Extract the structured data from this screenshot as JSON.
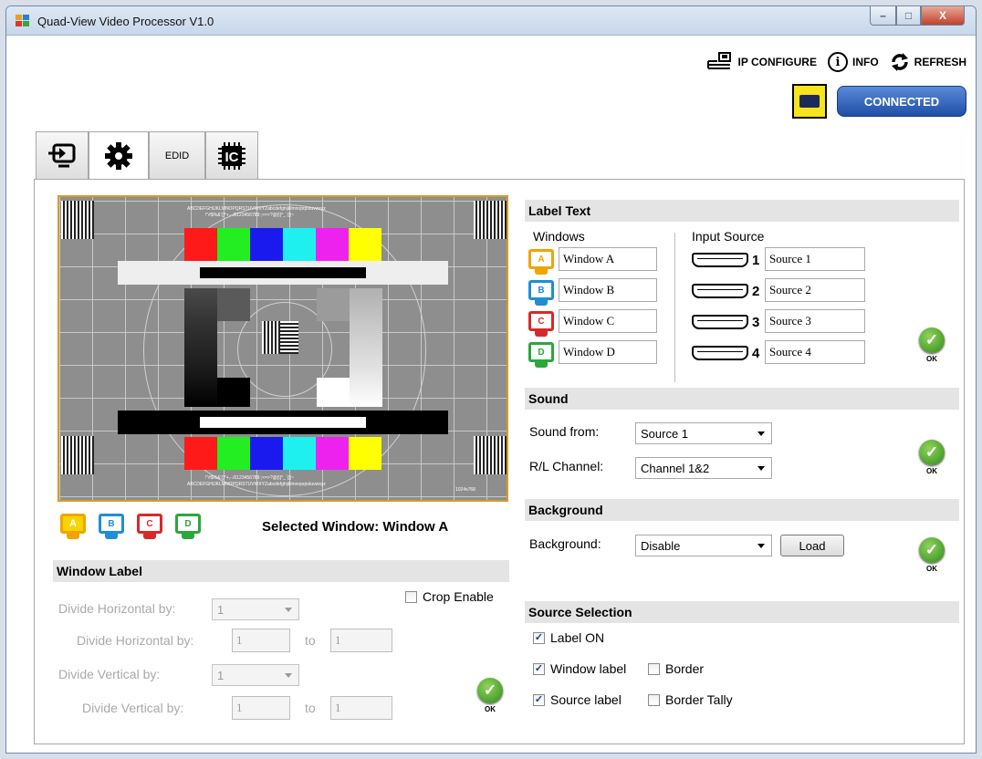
{
  "window": {
    "title": "Quad-View Video Processor V1.0",
    "minimize": "–",
    "maximize": "□",
    "close": "X"
  },
  "toolbar": {
    "ip_configure": "IP CONFIGURE",
    "info": "INFO",
    "refresh": "REFRESH",
    "info_glyph": "i",
    "connection_status": "CONNECTED"
  },
  "tabs": [
    {
      "name": "input-tab",
      "icon": "input-icon"
    },
    {
      "name": "settings-tab",
      "icon": "gear-icon",
      "active": true
    },
    {
      "name": "edid-tab",
      "label": "EDID"
    },
    {
      "name": "ic-tab",
      "icon": "ic-chip-icon",
      "label": "IC"
    }
  ],
  "testcard": {
    "top_text_1": "ABCDEFGHIJKLMNOPQRSTUVWXYZabcdefghijklmnopqrstuvwxyz",
    "top_text_2": "!\"#$%&'()*+,-./0123456789:;<=>?@[\\]^_`{|}~",
    "bottom_text_1": "!\"#$%&'()*+,-./0123456789:;<=>?@[\\]^_`{|}~",
    "bottom_text_2": "ABCDEFGHIJKLMNOPQRSTUVWXYZabcdefghijklmnopqrstuvwxyz",
    "resolution": "1024x768"
  },
  "window_selector": {
    "icons": [
      {
        "letter": "A",
        "color": "#f0a400",
        "fill": "#f7d400"
      },
      {
        "letter": "B",
        "color": "#1f8ed6"
      },
      {
        "letter": "C",
        "color": "#d62a2a"
      },
      {
        "letter": "D",
        "color": "#2aa83a"
      }
    ],
    "selected_text": "Selected Window: Window A"
  },
  "window_label": {
    "header": "Window Label",
    "crop_enable": "Crop Enable",
    "divide_h_label": "Divide Horizontal by:",
    "divide_h_value": "1",
    "divide_h2_label": "Divide Horizontal by:",
    "divide_h2_from": "1",
    "divide_h2_to_label": "to",
    "divide_h2_to": "1",
    "divide_v_label": "Divide Vertical by:",
    "divide_v_value": "1",
    "divide_v2_label": "Divide Vertical by:",
    "divide_v2_from": "1",
    "divide_v2_to_label": "to",
    "divide_v2_to": "1",
    "ok": "OK"
  },
  "label_text": {
    "header": "Label Text",
    "windows_title": "Windows",
    "input_source_title": "Input Source",
    "windows": [
      "Window A",
      "Window B",
      "Window C",
      "Window D"
    ],
    "sources": [
      {
        "num": "1",
        "value": "Source 1"
      },
      {
        "num": "2",
        "value": "Source 2"
      },
      {
        "num": "3",
        "value": "Source 3"
      },
      {
        "num": "4",
        "value": "Source 4"
      }
    ],
    "ok": "OK"
  },
  "sound": {
    "header": "Sound",
    "from_label": "Sound from:",
    "from_value": "Source 1",
    "channel_label": "R/L Channel:",
    "channel_value": "Channel 1&2",
    "ok": "OK"
  },
  "background": {
    "header": "Background",
    "label": "Background:",
    "value": "Disable",
    "load": "Load",
    "ok": "OK"
  },
  "source_selection": {
    "header": "Source Selection",
    "label_on": "Label ON",
    "window_label": "Window label",
    "border": "Border",
    "source_label": "Source label",
    "border_tally": "Border Tally",
    "check_mark": "✓"
  },
  "colors": {
    "accent_blue": "#1e4fa7",
    "ok_green": "#2f8a1a",
    "serial_yellow": "#f7e41a"
  }
}
